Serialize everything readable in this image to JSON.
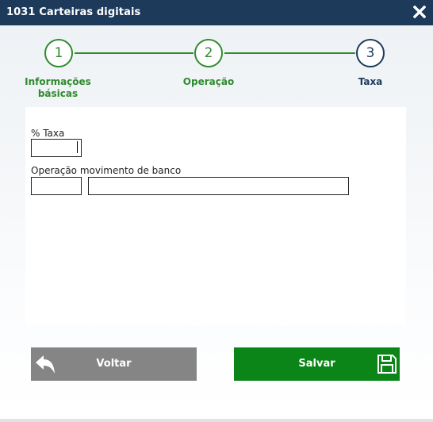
{
  "window": {
    "title": "1031 Carteiras digitais",
    "close_icon": "close-icon"
  },
  "wizard": {
    "steps": [
      {
        "number": "1",
        "label_line1": "Informações",
        "label_line2": "básicas",
        "state": "done"
      },
      {
        "number": "2",
        "label": "Operação",
        "state": "done"
      },
      {
        "number": "3",
        "label": "Taxa",
        "state": "active"
      }
    ],
    "colors": {
      "done": "#2e8b2e",
      "active": "#1d3a5b"
    }
  },
  "form": {
    "taxa_label": "% Taxa",
    "taxa_value": "",
    "operacao_label": "Operação movimento de banco",
    "operacao_code": "",
    "operacao_desc": ""
  },
  "buttons": {
    "back_label": "Voltar",
    "back_icon": "undo-arrow-icon",
    "save_label": "Salvar",
    "save_icon": "floppy-disk-icon"
  },
  "colors": {
    "titlebar": "#1d3a5b",
    "save": "#0c8518",
    "back": "#858585"
  }
}
